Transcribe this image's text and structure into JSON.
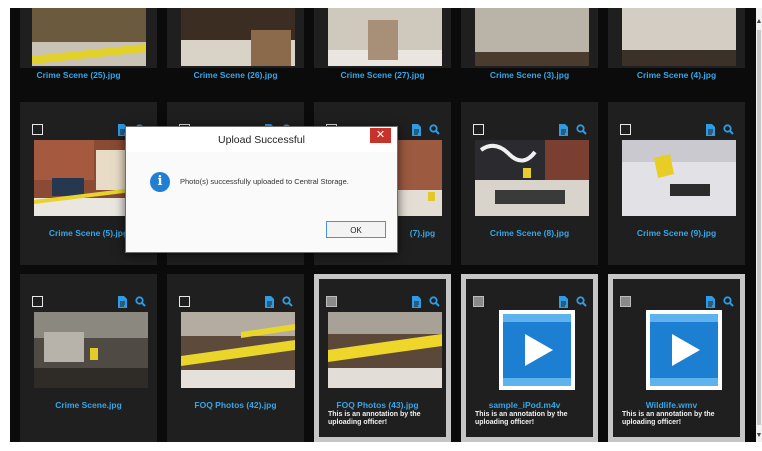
{
  "gallery": {
    "tiles": [
      {
        "caption": "Crime Scene (25).jpg"
      },
      {
        "caption": "Crime Scene (26).jpg"
      },
      {
        "caption": "Crime Scene (27).jpg"
      },
      {
        "caption": "Crime Scene (3).jpg"
      },
      {
        "caption": "Crime Scene (4).jpg"
      },
      {
        "caption": "Crime Scene (5).jpg"
      },
      {
        "caption": ""
      },
      {
        "caption": "(7).jpg"
      },
      {
        "caption": "Crime Scene (8).jpg"
      },
      {
        "caption": "Crime Scene (9).jpg"
      },
      {
        "caption": "Crime Scene.jpg"
      },
      {
        "caption": "FOQ Photos (42).jpg"
      },
      {
        "caption": "FOQ Photos (43).jpg",
        "annotation": "This is an annotation by the uploading officer!"
      },
      {
        "caption": "sample_iPod.m4v",
        "annotation": "This is an annotation by the uploading officer!"
      },
      {
        "caption": "Wildlife.wmv",
        "annotation": "This is an annotation by the uploading officer!"
      }
    ]
  },
  "dialog": {
    "title": "Upload Successful",
    "message": "Photo(s) successfully uploaded to Central Storage.",
    "ok_label": "OK",
    "close_glyph": "✕",
    "info_glyph": "i"
  },
  "icons": {
    "details": "document-icon",
    "preview": "magnifier-icon",
    "info": "info-icon",
    "play": "play-icon"
  },
  "colors": {
    "caption": "#36a6e6",
    "tile_bg": "#1f1f1f",
    "selected_border": "#c6c6c6",
    "dialog_close": "#c7322a",
    "info": "#1f7fd4"
  }
}
